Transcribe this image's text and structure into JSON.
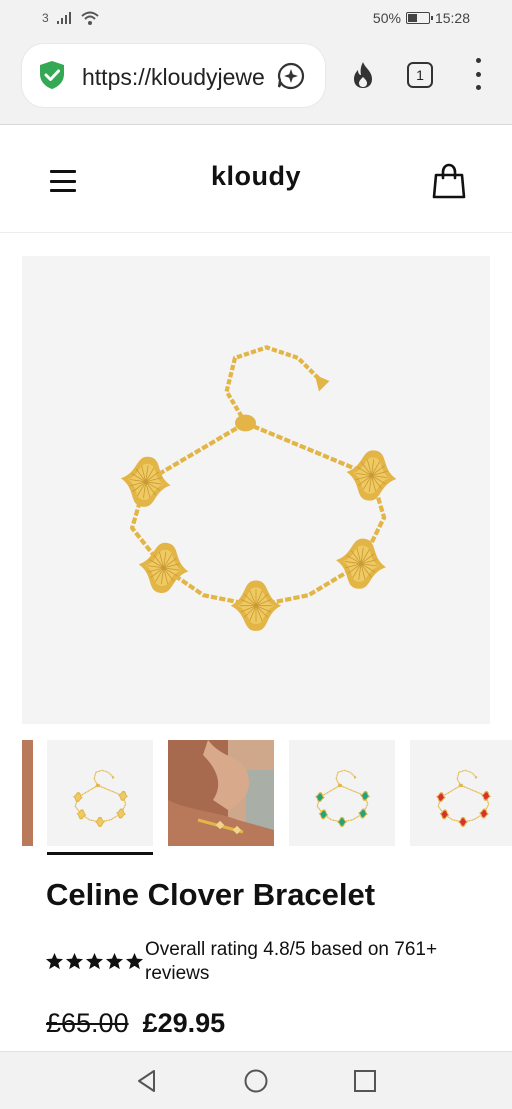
{
  "status_bar": {
    "sim_label": "3",
    "battery_text": "50%",
    "battery_level": 0.5,
    "time": "15:28"
  },
  "browser": {
    "url": "https://kloudyjewellery.co.uk",
    "tab_count": "1",
    "icons": [
      "shield-check-icon",
      "sparkle-icon",
      "fire-icon",
      "tabs-icon",
      "more-vert-icon"
    ],
    "accent": "#34a853"
  },
  "site": {
    "logo": "kloudy",
    "icons": [
      "hamburger-menu-icon",
      "shopping-bag-icon"
    ]
  },
  "product": {
    "title": "Celine Clover Bracelet",
    "rating_stars": 5,
    "rating_text": "Overall rating 4.8/5 based on 761+ reviews",
    "price_old": "£65.00",
    "price_new": "£29.95",
    "thumbnails": [
      "gold",
      "model",
      "green",
      "red"
    ],
    "selected_thumbnail": 0,
    "colors": {
      "gold": "#e2b546",
      "green": "#1fa57a",
      "red": "#d8302c"
    }
  },
  "nav": {
    "icons": [
      "back-triangle-icon",
      "home-circle-icon",
      "recents-square-icon"
    ]
  }
}
